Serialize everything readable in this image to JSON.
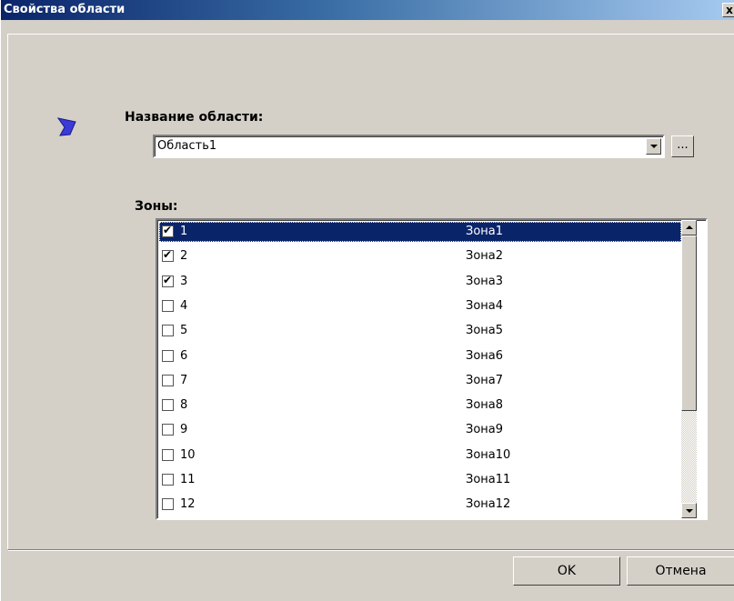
{
  "window": {
    "title": "Свойства области",
    "close_label": "x"
  },
  "area_name": {
    "label": "Название области:",
    "value": "Область1",
    "browse_label": "..."
  },
  "zones": {
    "label": "Зоны:",
    "items": [
      {
        "num": "1",
        "name": "Зона1",
        "checked": true,
        "selected": true
      },
      {
        "num": "2",
        "name": "Зона2",
        "checked": true,
        "selected": false
      },
      {
        "num": "3",
        "name": "Зона3",
        "checked": true,
        "selected": false
      },
      {
        "num": "4",
        "name": "Зона4",
        "checked": false,
        "selected": false
      },
      {
        "num": "5",
        "name": "Зона5",
        "checked": false,
        "selected": false
      },
      {
        "num": "6",
        "name": "Зона6",
        "checked": false,
        "selected": false
      },
      {
        "num": "7",
        "name": "Зона7",
        "checked": false,
        "selected": false
      },
      {
        "num": "8",
        "name": "Зона8",
        "checked": false,
        "selected": false
      },
      {
        "num": "9",
        "name": "Зона9",
        "checked": false,
        "selected": false
      },
      {
        "num": "10",
        "name": "Зона10",
        "checked": false,
        "selected": false
      },
      {
        "num": "11",
        "name": "Зона11",
        "checked": false,
        "selected": false
      },
      {
        "num": "12",
        "name": "Зона12",
        "checked": false,
        "selected": false
      }
    ]
  },
  "buttons": {
    "ok": "OK",
    "cancel": "Отмена"
  },
  "colors": {
    "titlebar_start": "#0a246a",
    "titlebar_end": "#a6caf0",
    "dialog_bg": "#d4d0c8",
    "selection": "#0a246a",
    "icon": "#3b3bd6"
  },
  "icons": {
    "area": "area-icon",
    "check": "check-icon"
  }
}
